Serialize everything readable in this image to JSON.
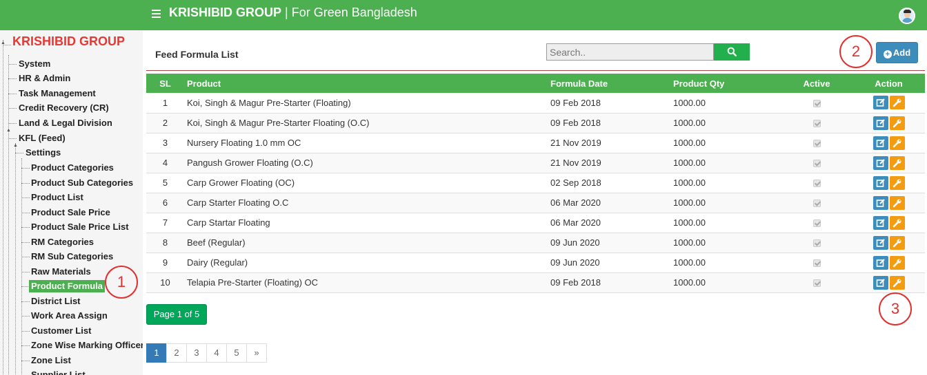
{
  "header": {
    "brand": "KRISHIBID GROUP",
    "tagline": " | For Green Bangladesh",
    "menu_icon": "hamburger-icon",
    "avatar_icon": "user-avatar"
  },
  "sidebar": {
    "root": "KRISHIBID GROUP",
    "items": [
      "System",
      "HR & Admin",
      "Task Management",
      "Credit Recovery (CR)",
      "Land & Legal Division",
      "KFL (Feed)"
    ],
    "settings_label": "Settings",
    "settings_items": [
      "Product Categories",
      "Product Sub Categories",
      "Product List",
      "Product Sale Price",
      "Product Sale Price List",
      "RM Categories",
      "RM Sub Categories",
      "Raw Materials",
      "Product Formula",
      "District List",
      "Work Area Assign",
      "Customer List",
      "Zone Wise Marking Officer",
      "Zone List",
      "Supplier List"
    ],
    "active_item": "Product Formula"
  },
  "main": {
    "title": "Feed Formula List",
    "search_placeholder": "Search..",
    "search_icon": "search-icon",
    "add_label": "Add",
    "add_icon": "plus-circle-icon"
  },
  "table": {
    "columns": [
      "SL",
      "Product",
      "Formula Date",
      "Product Qty",
      "Active",
      "Action"
    ],
    "rows": [
      {
        "sl": "1",
        "product": "Koi, Singh & Magur Pre-Starter (Floating)",
        "date": "09 Feb 2018",
        "qty": "1000.00",
        "active": true
      },
      {
        "sl": "2",
        "product": "Koi, Singh & Magur Pre-Starter Floating (O.C)",
        "date": "09 Feb 2018",
        "qty": "1000.00",
        "active": true
      },
      {
        "sl": "3",
        "product": "Nursery Floating 1.0 mm OC",
        "date": "21 Nov 2019",
        "qty": "1000.00",
        "active": true
      },
      {
        "sl": "4",
        "product": "Pangush Grower Floating (O.C)",
        "date": "21 Nov 2019",
        "qty": "1000.00",
        "active": true
      },
      {
        "sl": "5",
        "product": "Carp Grower Floating (OC)",
        "date": "02 Sep 2018",
        "qty": "1000.00",
        "active": true
      },
      {
        "sl": "6",
        "product": "Carp Starter Floating O.C",
        "date": "06 Mar 2020",
        "qty": "1000.00",
        "active": true
      },
      {
        "sl": "7",
        "product": "Carp Startar Floating",
        "date": "06 Mar 2020",
        "qty": "1000.00",
        "active": true
      },
      {
        "sl": "8",
        "product": "Beef (Regular)",
        "date": "09 Jun 2020",
        "qty": "1000.00",
        "active": true
      },
      {
        "sl": "9",
        "product": "Dairy (Regular)",
        "date": "09 Jun 2020",
        "qty": "1000.00",
        "active": true
      },
      {
        "sl": "10",
        "product": "Telapia Pre-Starter (Floating) OC",
        "date": "09 Feb 2018",
        "qty": "1000.00",
        "active": true
      }
    ]
  },
  "pagination": {
    "info": "Page 1 of 5",
    "pages": [
      "1",
      "2",
      "3",
      "4",
      "5",
      "»"
    ],
    "current": "1"
  },
  "callouts": [
    "1",
    "2",
    "3"
  ],
  "colors": {
    "header_green": "#4caf50",
    "root_red": "#e53935",
    "edit_blue": "#3c8dbc",
    "wrench_orange": "#f39c12",
    "callout_red": "#e03030"
  }
}
